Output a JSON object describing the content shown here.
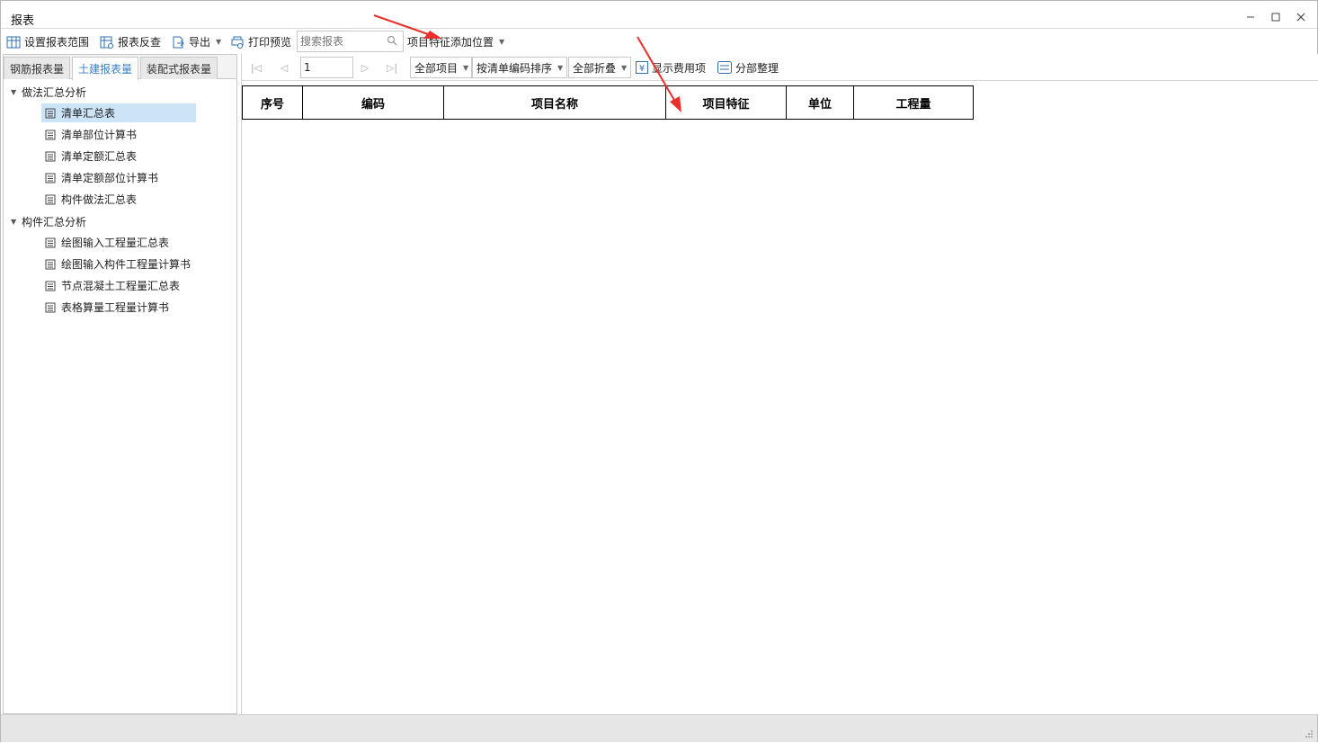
{
  "window": {
    "title": "报表"
  },
  "toolbar": {
    "set_range": "设置报表范围",
    "reverse_check": "报表反查",
    "export": "导出",
    "print_preview": "打印预览",
    "search_placeholder": "搜索报表",
    "feature_position": "项目特征添加位置"
  },
  "tabs": [
    "钢筋报表量",
    "土建报表量",
    "装配式报表量"
  ],
  "active_tab": "土建报表量",
  "tree": {
    "group1": {
      "label": "做法汇总分析",
      "items": [
        "清单汇总表",
        "清单部位计算书",
        "清单定额汇总表",
        "清单定额部位计算书",
        "构件做法汇总表"
      ]
    },
    "group2": {
      "label": "构件汇总分析",
      "items": [
        "绘图输入工程量汇总表",
        "绘图输入构件工程量计算书",
        "节点混凝土工程量汇总表",
        "表格算量工程量计算书"
      ]
    },
    "selected": "清单汇总表"
  },
  "report_toolbar": {
    "page": "1",
    "all_items": "全部项目",
    "sort_by": "按清单编码排序",
    "collapse_all": "全部折叠",
    "show_fee_items": "显示费用项",
    "section_arrange": "分部整理"
  },
  "report_table": {
    "headers": [
      "序号",
      "编码",
      "项目名称",
      "项目特征",
      "单位",
      "工程量"
    ]
  },
  "colors": {
    "accent": "#3a7fc1",
    "selection": "#cce4f7",
    "annotation_arrow": "#e8302c"
  }
}
